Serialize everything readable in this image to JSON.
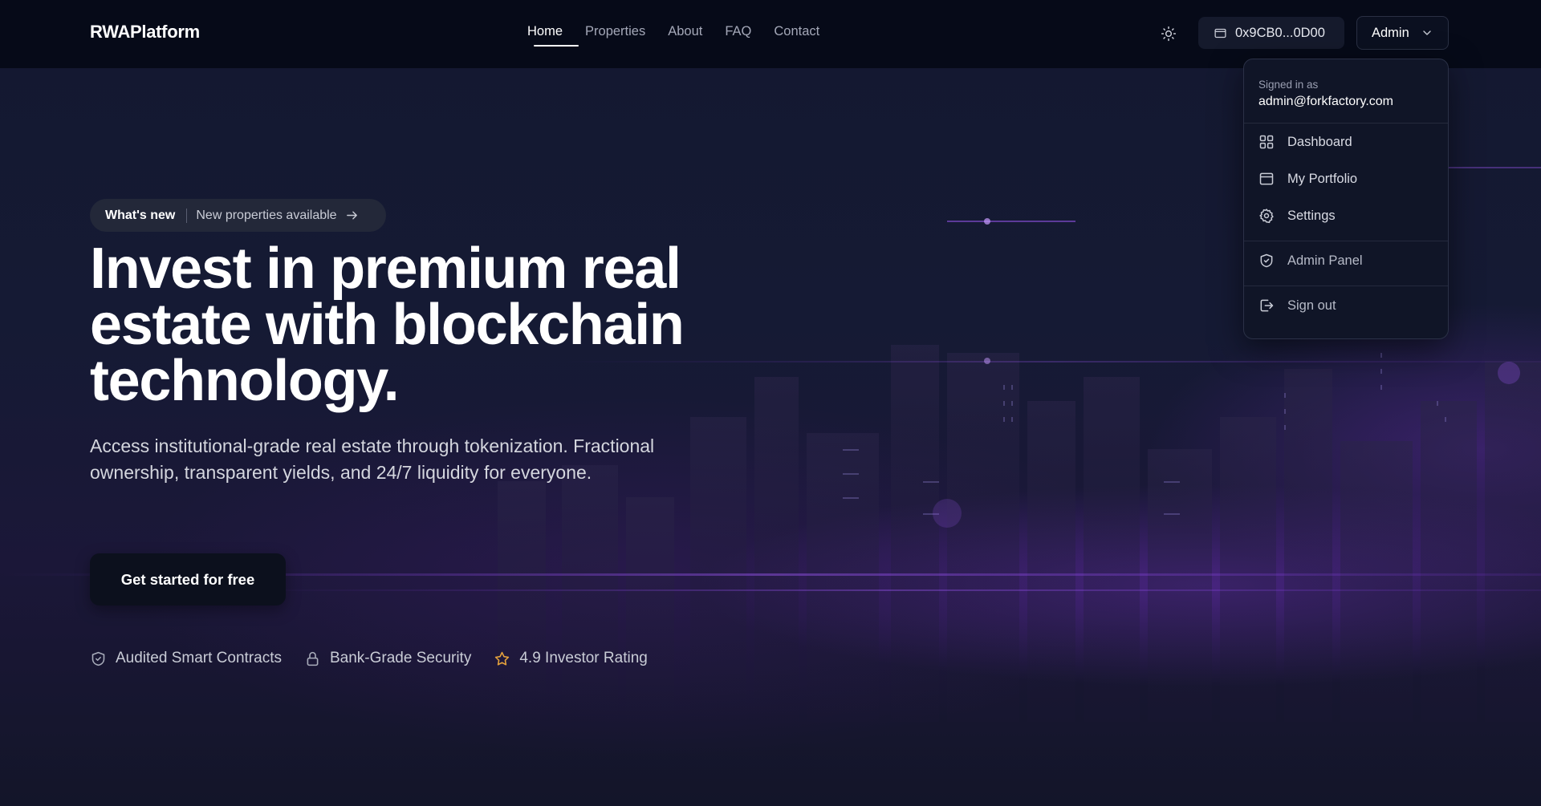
{
  "brand": {
    "name": "RWAPlatform"
  },
  "nav": {
    "items": [
      {
        "label": "Home",
        "active": true
      },
      {
        "label": "Properties",
        "active": false
      },
      {
        "label": "About",
        "active": false
      },
      {
        "label": "FAQ",
        "active": false
      },
      {
        "label": "Contact",
        "active": false
      }
    ]
  },
  "header": {
    "theme_icon": "sun-icon",
    "wallet": {
      "icon": "wallet-icon",
      "address": "0x9CB0...0D00"
    },
    "user_menu": {
      "label": "Admin",
      "icon": "chevron-down-icon"
    }
  },
  "dropdown": {
    "signed_in_label": "Signed in as",
    "email": "admin@forkfactory.com",
    "items": [
      {
        "label": "Dashboard",
        "icon": "grid-icon"
      },
      {
        "label": "My Portfolio",
        "icon": "portfolio-icon"
      },
      {
        "label": "Settings",
        "icon": "gear-icon"
      },
      {
        "label": "Admin Panel",
        "icon": "shield-icon"
      },
      {
        "label": "Sign out",
        "icon": "sign-out-icon"
      }
    ]
  },
  "hero": {
    "badge": {
      "tag": "What's new",
      "text": "New properties available",
      "icon": "arrow-right-icon"
    },
    "title": {
      "line1": "Invest in premium real",
      "line2": "estate with blockchain",
      "line3": "technology."
    },
    "subtitle": {
      "line1": "Access institutional-grade real estate through tokenization. Fractional",
      "line2": "ownership, transparent yields, and 24/7 liquidity for everyone."
    },
    "cta_label": "Get started for free",
    "features": [
      {
        "label": "Audited Smart Contracts",
        "icon": "shield-check-icon"
      },
      {
        "label": "Bank-Grade Security",
        "icon": "lock-icon"
      },
      {
        "label": "4.9 Investor Rating",
        "icon": "star-icon"
      }
    ]
  },
  "colors": {
    "header_bg": "#060a18",
    "page_bg": "#121629",
    "accent_purple": "#7e34d6",
    "star": "#e6a23c"
  }
}
